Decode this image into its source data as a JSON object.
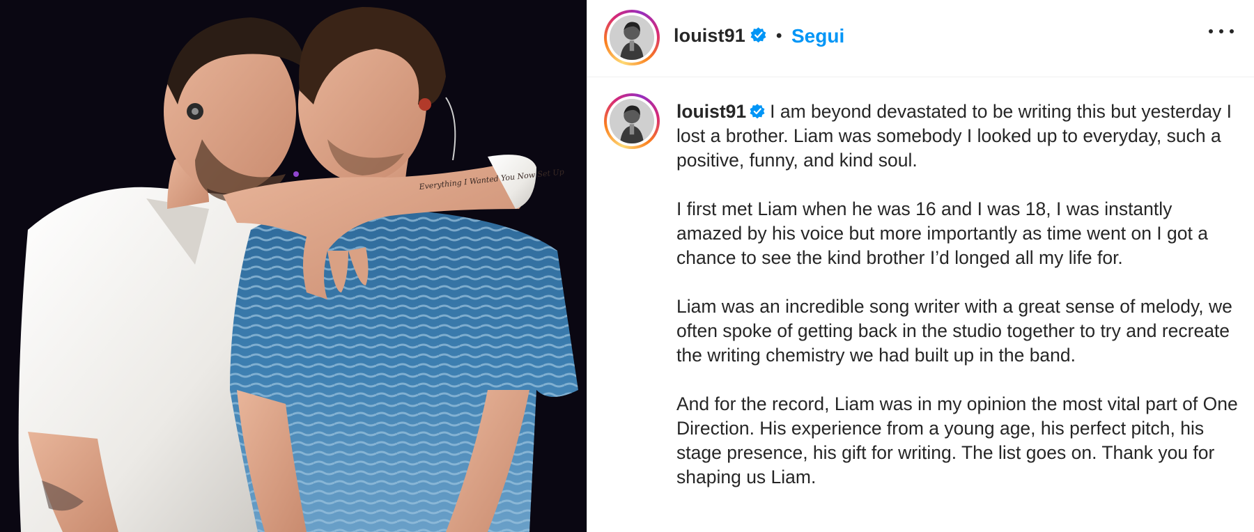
{
  "post": {
    "username": "louist91",
    "follow_label": "Segui",
    "separator": "•",
    "verified_icon": "verified-badge-icon",
    "more_icon": "more-options-icon",
    "accent_color": "#0095f6",
    "verified_color": "#0095f6"
  },
  "caption": {
    "username": "louist91",
    "paragraphs": [
      "I am beyond devastated to be writing this but yesterday I lost a brother. Liam was somebody I looked up to everyday, such a positive, funny, and kind soul.",
      "I first met Liam when he was 16 and I was 18, I was instantly amazed by his voice but more importantly as time went on I got a chance to see the kind brother I’d longed all my life for.",
      "Liam was an incredible song writer with a great sense of melody, we often spoke of getting back in the studio together to try and recreate the writing chemistry we had built up in the band.",
      "And for the record, Liam was in my opinion the most vital part of One Direction. His experience from a young age, his perfect pitch, his stage presence, his gift for writing. The list goes on. Thank you for shaping us Liam."
    ]
  },
  "photo": {
    "tattoo_text": "Everything I Wanted You Now Set Up"
  }
}
